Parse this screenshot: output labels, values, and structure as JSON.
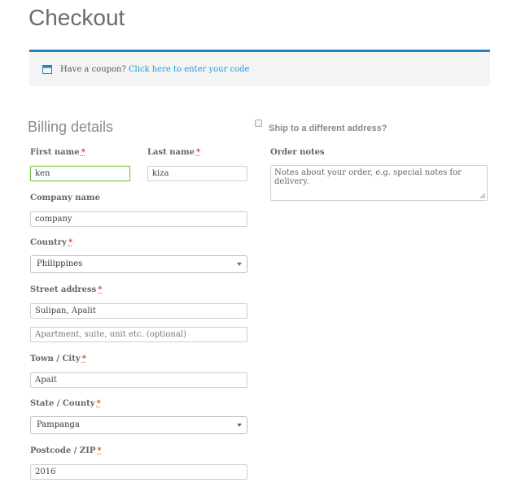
{
  "page": {
    "title": "Checkout"
  },
  "coupon": {
    "prompt": "Have a coupon?",
    "link": "Click here to enter your code"
  },
  "billing": {
    "title": "Billing details",
    "required_marker": "*",
    "first_name": {
      "label": "First name",
      "value": "ken"
    },
    "last_name": {
      "label": "Last name",
      "value": "kiza"
    },
    "company": {
      "label": "Company name",
      "value": "company"
    },
    "country": {
      "label": "Country",
      "value": "Philippines"
    },
    "street": {
      "label": "Street address",
      "value": "Sulipan, Apalit",
      "placeholder2": "Apartment, suite, unit etc. (optional)"
    },
    "city": {
      "label": "Town / City",
      "value": "Apait"
    },
    "state": {
      "label": "State / County",
      "value": "Pampanga"
    },
    "postcode": {
      "label": "Postcode / ZIP",
      "value": "2016"
    }
  },
  "shipping": {
    "checkbox_label": "Ship to a different address?",
    "checked": false
  },
  "order_notes": {
    "label": "Order notes",
    "placeholder": "Notes about your order, e.g. special notes for delivery."
  },
  "colors": {
    "accent": "#1e85be",
    "link": "#1e9bd7",
    "required": "#e2401c",
    "focus": "#7ac142"
  }
}
